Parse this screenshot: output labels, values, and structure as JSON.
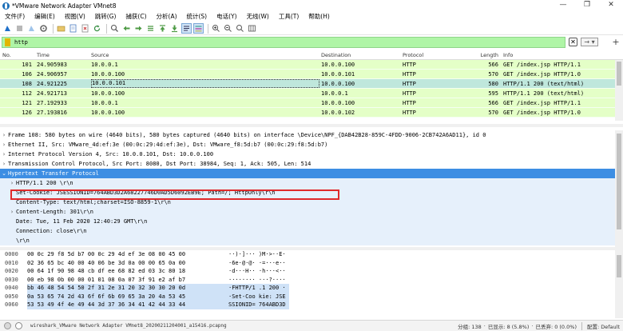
{
  "window": {
    "title": "*VMware Network Adapter VMnet8",
    "controls": [
      "—",
      "❐",
      "✕"
    ]
  },
  "menu": [
    "文件(F)",
    "编辑(E)",
    "视图(V)",
    "跳转(G)",
    "捕获(C)",
    "分析(A)",
    "统计(S)",
    "电话(Y)",
    "无线(W)",
    "工具(T)",
    "帮助(H)"
  ],
  "toolbar_icons": [
    "shark-fin-start-icon",
    "stop-icon",
    "restart-icon",
    "options-gear-icon",
    "open-file-icon",
    "save-file-icon",
    "close-file-icon",
    "reload-icon",
    "find-icon",
    "go-back-icon",
    "go-forward-icon",
    "go-to-packet-icon",
    "first-packet-icon",
    "last-packet-icon",
    "auto-scroll-icon",
    "colorize-icon",
    "zoom-in-icon",
    "zoom-out-icon",
    "normal-size-icon",
    "resize-columns-icon"
  ],
  "filter": {
    "value": "http",
    "clear_label": "✕",
    "apply_label": "→ ▾",
    "add_label": "+"
  },
  "packet_list": {
    "columns": [
      "No.",
      "Time",
      "Source",
      "Destination",
      "Protocol",
      "Length",
      "Info"
    ],
    "rows": [
      {
        "no": "101",
        "time": "24.905983",
        "src": "10.0.0.1",
        "dst": "10.0.0.100",
        "proto": "HTTP",
        "len": "566",
        "info": "GET /index.jsp HTTP/1.1"
      },
      {
        "no": "106",
        "time": "24.906957",
        "src": "10.0.0.100",
        "dst": "10.0.0.101",
        "proto": "HTTP",
        "len": "570",
        "info": "GET /index.jsp HTTP/1.0"
      },
      {
        "no": "108",
        "time": "24.921225",
        "src": "10.0.0.101",
        "dst": "10.0.0.100",
        "proto": "HTTP",
        "len": "580",
        "info": "HTTP/1.1 200   (text/html)"
      },
      {
        "no": "112",
        "time": "24.921713",
        "src": "10.0.0.100",
        "dst": "10.0.0.1",
        "proto": "HTTP",
        "len": "595",
        "info": "HTTP/1.1 200   (text/html)"
      },
      {
        "no": "121",
        "time": "27.192933",
        "src": "10.0.0.1",
        "dst": "10.0.0.100",
        "proto": "HTTP",
        "len": "566",
        "info": "GET /index.jsp HTTP/1.1"
      },
      {
        "no": "126",
        "time": "27.193816",
        "src": "10.0.0.100",
        "dst": "10.0.0.102",
        "proto": "HTTP",
        "len": "570",
        "info": "GET /index.jsp HTTP/1.0"
      }
    ]
  },
  "details": [
    {
      "arrow": "›",
      "indent": 0,
      "text": "Frame 108: 580 bytes on wire (4640 bits), 580 bytes captured (4640 bits) on interface \\Device\\NPF_{DAB42B28-859C-4FDD-9006-2CB742A6AD11}, id 0"
    },
    {
      "arrow": "›",
      "indent": 0,
      "text": "Ethernet II, Src: VMware_4d:ef:3e (00:0c:29:4d:ef:3e), Dst: VMware_f8:5d:b7 (00:0c:29:f8:5d:b7)"
    },
    {
      "arrow": "›",
      "indent": 0,
      "text": "Internet Protocol Version 4, Src: 10.0.0.101, Dst: 10.0.0.100"
    },
    {
      "arrow": "›",
      "indent": 0,
      "text": "Transmission Control Protocol, Src Port: 8080, Dst Port: 38984, Seq: 1, Ack: 505, Len: 514"
    },
    {
      "arrow": "⌄",
      "indent": 0,
      "text": "Hypertext Transfer Protocol"
    },
    {
      "arrow": "›",
      "indent": 1,
      "text": "HTTP/1.1 200 \\r\\n"
    },
    {
      "arrow": "",
      "indent": 1,
      "text": "Set-Cookie: JSESSIONID=764ABD3D2A68227746D0AD5D6092EB9E; Path=/; HttpOnly\\r\\n"
    },
    {
      "arrow": "",
      "indent": 1,
      "text": "Content-Type: text/html;charset=ISO-8859-1\\r\\n"
    },
    {
      "arrow": "›",
      "indent": 1,
      "text": "Content-Length: 301\\r\\n"
    },
    {
      "arrow": "",
      "indent": 1,
      "text": "Date: Tue, 11 Feb 2020 12:40:29 GMT\\r\\n"
    },
    {
      "arrow": "",
      "indent": 1,
      "text": "Connection: close\\r\\n"
    },
    {
      "arrow": "",
      "indent": 1,
      "text": "\\r\\n"
    }
  ],
  "bytes": [
    {
      "off": "0000",
      "hex": "00 0c 29 f8 5d b7 00 0c  29 4d ef 3e 08 00 45 00",
      "ascii": "··)·]··· )M·>··E·"
    },
    {
      "off": "0010",
      "hex": "02 36 65 bc 40 00 40 06  be 3d 0a 00 00 65 0a 00",
      "ascii": "·6e·@·@· ·=···e··"
    },
    {
      "off": "0020",
      "hex": "00 64 1f 90 98 48 cb df  ee 68 82 ed 03 3c 80 18",
      "ascii": "·d···H·· ·h···<··"
    },
    {
      "off": "0030",
      "hex": "00 eb 98 0b 00 00 01 01  08 0a 07 3f 91 e2 af b7",
      "ascii": "········ ···?····"
    },
    {
      "off": "0040",
      "hex": "bb 46 48 54 54 50 2f 31  2e 31 20 32 30 30 20 0d",
      "ascii": "·FHTTP/1 .1 200 ·"
    },
    {
      "off": "0050",
      "hex": "0a 53 65 74 2d 43 6f 6f  6b 69 65 3a 20 4a 53 45",
      "ascii": "·Set-Coo kie: JSE"
    },
    {
      "off": "0060",
      "hex": "53 53 49 4f 4e 49 44 3d  37 36 34 41 42 44 33 44",
      "ascii": "SSIONID= 764ABD3D"
    }
  ],
  "status": {
    "file": "wireshark_VMware Network Adapter VMnet8_20200211204001_a15416.pcapng",
    "packets": "分组: 138",
    "displayed": "已显示: 8 (5.8%)",
    "dropped": "已丢弃: 0 (0.0%)",
    "profile": "配置: Default"
  },
  "colors": {
    "http_row": "#e4ffc7",
    "selected_row": "#bfe7dc",
    "filter_ok": "#aff5a6",
    "tree_highlight": "#3d8ee3",
    "cookie_outline": "#e0292a"
  }
}
